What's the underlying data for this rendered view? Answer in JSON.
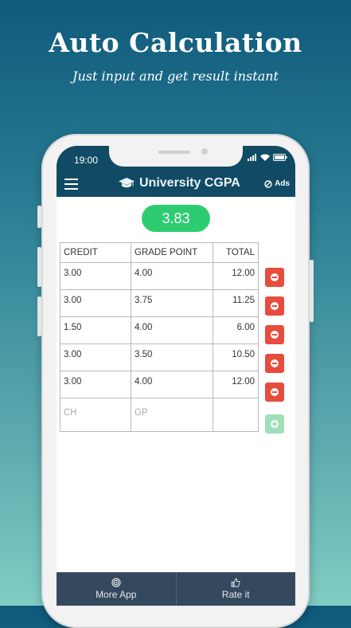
{
  "promo": {
    "title": "Auto Calculation",
    "subtitle": "Just input and get result instant"
  },
  "status_bar": {
    "time": "19:00"
  },
  "app_bar": {
    "title": "University CGPA",
    "ads_label": "Ads"
  },
  "result": {
    "cgpa": "3.83"
  },
  "table": {
    "headers": {
      "credit": "CREDIT",
      "grade_point": "GRADE POINT",
      "total": "TOTAL"
    },
    "rows": [
      {
        "credit": "3.00",
        "grade_point": "4.00",
        "total": "12.00"
      },
      {
        "credit": "3.00",
        "grade_point": "3.75",
        "total": "11.25"
      },
      {
        "credit": "1.50",
        "grade_point": "4.00",
        "total": "6.00"
      },
      {
        "credit": "3.00",
        "grade_point": "3.50",
        "total": "10.50"
      },
      {
        "credit": "3.00",
        "grade_point": "4.00",
        "total": "12.00"
      }
    ],
    "input_placeholders": {
      "credit": "CH",
      "grade_point": "GP"
    }
  },
  "bottom_bar": {
    "more_app": "More App",
    "rate_it": "Rate it"
  },
  "colors": {
    "app_bar": "#114a64",
    "result_pill": "#2ecc71",
    "delete_button": "#e74c3c",
    "add_button": "#9fe0b8",
    "bottom_bar": "#34495e"
  },
  "icons": {
    "menu": "hamburger-icon",
    "title": "graduation-cap-icon",
    "ads": "no-ads-icon",
    "more_app": "target-icon",
    "rate_it": "thumbs-up-icon",
    "delete": "minus-circle-icon",
    "add": "plus-circle-icon"
  }
}
